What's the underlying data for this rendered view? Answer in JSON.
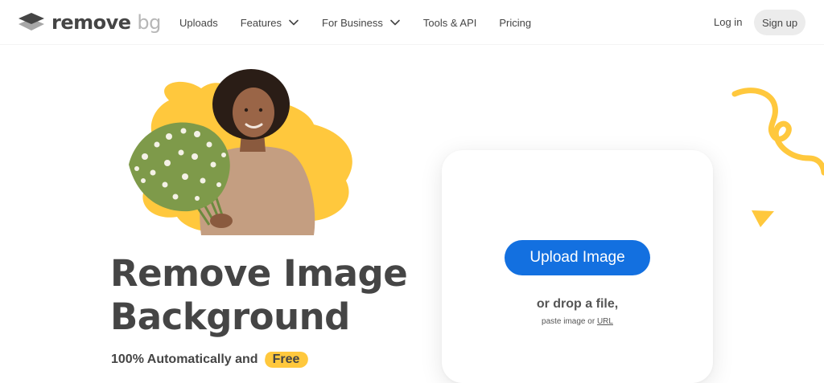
{
  "header": {
    "logo_text": "remove",
    "logo_suffix": "bg",
    "nav": [
      {
        "label": "Uploads"
      },
      {
        "label": "Features"
      },
      {
        "label": "For Business"
      },
      {
        "label": "Tools & API"
      },
      {
        "label": "Pricing"
      }
    ],
    "login_label": "Log in",
    "signup_label": "Sign up"
  },
  "hero": {
    "headline_line1": "Remove Image",
    "headline_line2": "Background",
    "tagline": "100% Automatically and",
    "tagline_highlight": "Free"
  },
  "upload": {
    "button_label": "Upload Image",
    "drop_text": "or drop a file,",
    "paste_prefix": "paste image or",
    "url_label": "URL"
  },
  "colors": {
    "accent_blue": "#1370e0",
    "accent_yellow": "#ffc83d",
    "text_dark": "#454545"
  }
}
